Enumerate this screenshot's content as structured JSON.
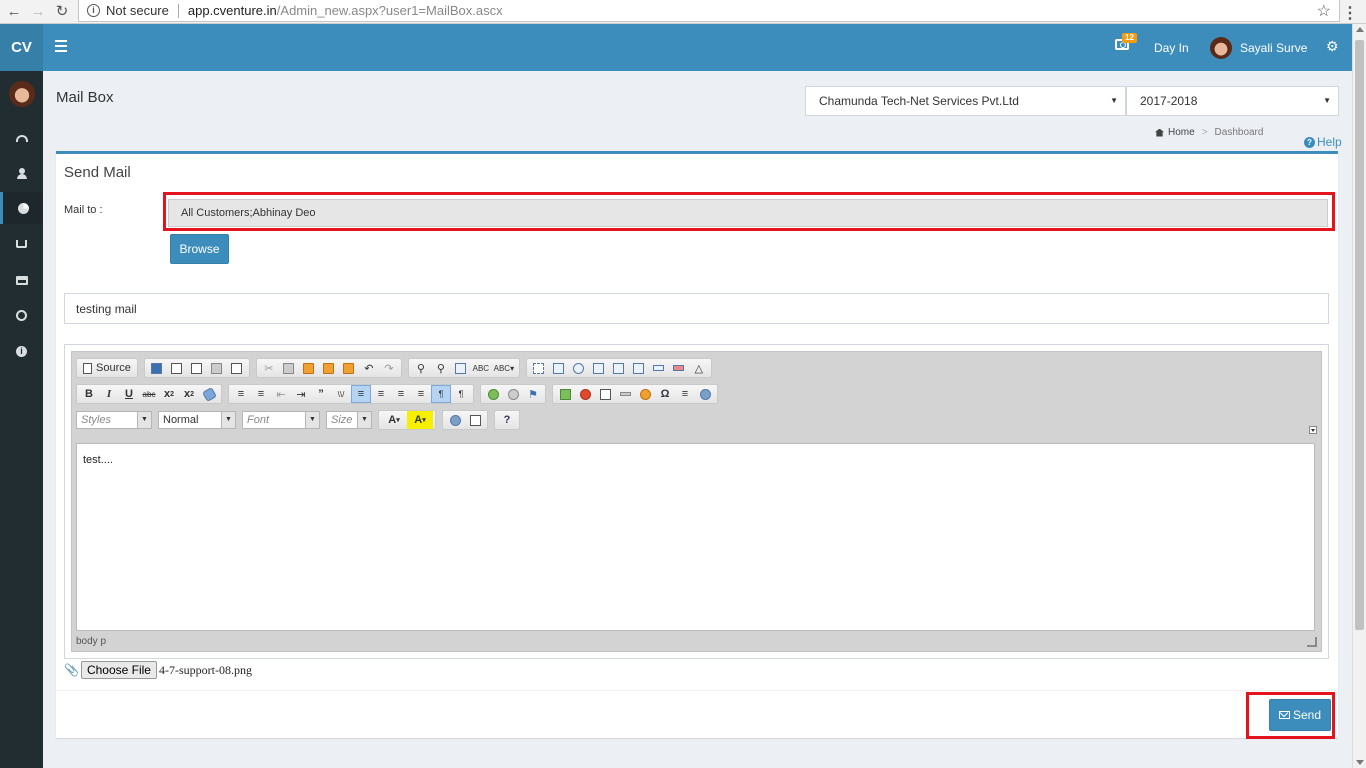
{
  "browser": {
    "back_icon": "arrow-left-icon",
    "forward_icon": "arrow-right-icon",
    "reload_icon": "reload-icon",
    "security_label": "Not secure",
    "url_host": "app.cventure.in",
    "url_path": "/Admin_new.aspx?user1=MailBox.ascx"
  },
  "header": {
    "logo": "CV",
    "notification_count": "12",
    "day_in_label": "Day In",
    "user_name": "Sayali Surve",
    "brand_color": "#3c8dbc"
  },
  "sidebar": {
    "items": [
      {
        "icon": "dashboard-icon"
      },
      {
        "icon": "user-icon"
      },
      {
        "icon": "pie-chart-icon",
        "active": true
      },
      {
        "icon": "shopping-cart-icon"
      },
      {
        "icon": "credit-card-icon"
      },
      {
        "icon": "life-ring-icon"
      },
      {
        "icon": "info-icon"
      }
    ]
  },
  "page": {
    "title": "Mail Box",
    "company_select": "Chamunda Tech-Net Services Pvt.Ltd",
    "year_select": "2017-2018",
    "breadcrumb_home": "Home",
    "breadcrumb_current": "Dashboard",
    "help_label": "Help"
  },
  "form": {
    "title": "Send Mail",
    "mail_to_label": "Mail to :",
    "mail_to_value": "All Customers;Abhinay Deo",
    "browse_label": "Browse",
    "subject_value": "testing mail",
    "editor": {
      "source_label": "Source",
      "styles_placeholder": "Styles",
      "format_value": "Normal",
      "font_placeholder": "Font",
      "size_placeholder": "Size",
      "body_text": "test....",
      "status_path": "body  p"
    },
    "choose_file_label": "Choose File",
    "file_name": "4-7-support-08.png",
    "send_label": "Send"
  },
  "highlight_color": "#e3141e"
}
